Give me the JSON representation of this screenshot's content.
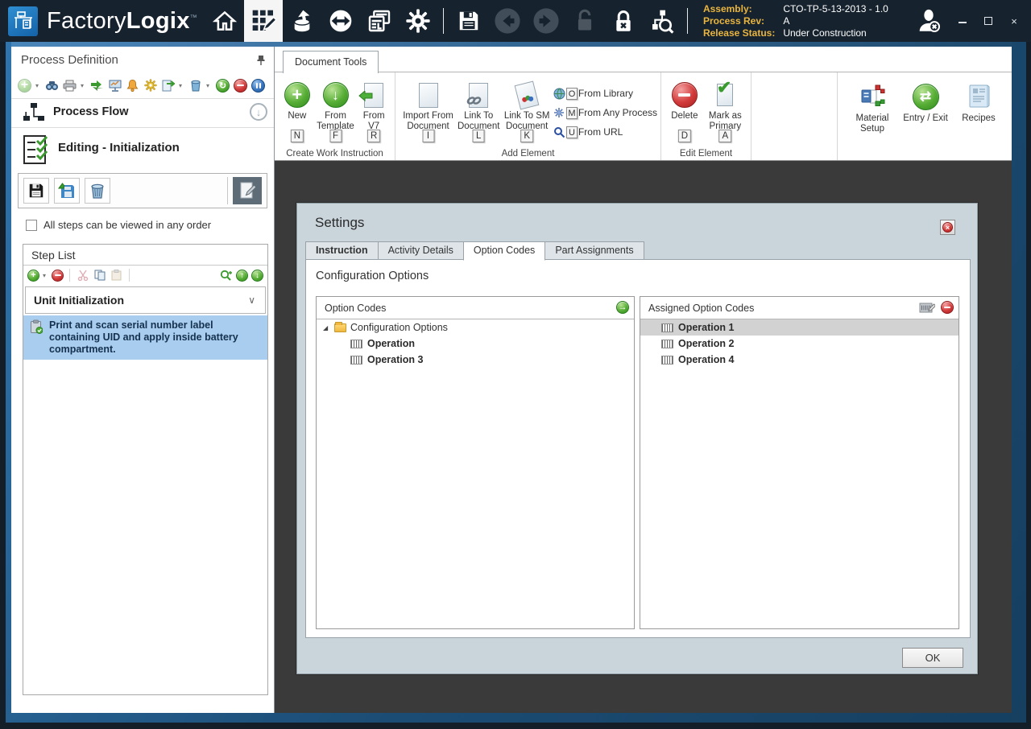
{
  "titlebar": {
    "brand_light": "Factory",
    "brand_bold": "Logix",
    "trademark": "™",
    "info": {
      "assembly_label": "Assembly:",
      "assembly_value": "CTO-TP-5-13-2013 - 1.0",
      "process_rev_label": "Process Rev:",
      "process_rev_value": "A",
      "release_status_label": "Release Status:",
      "release_status_value": "Under Construction"
    }
  },
  "left_panel": {
    "title": "Process Definition",
    "process_flow_label": "Process Flow",
    "editing_title": "Editing - Initialization",
    "steps_checkbox_label": "All steps can be viewed in any order",
    "step_list_title": "Step List",
    "step_group_title": "Unit Initialization",
    "step_text": "Print and scan serial number label containing UID and apply inside battery compartment."
  },
  "ribbon": {
    "tab_label": "Document Tools",
    "create_group": {
      "label": "Create Work Instruction",
      "new": {
        "label": "New",
        "keytip": "N"
      },
      "from_template": {
        "label": "From Template",
        "keytip": "F"
      },
      "from_v7": {
        "label": "From V7",
        "keytip": "R"
      }
    },
    "add_group": {
      "label": "Add Element",
      "import_from_document": {
        "label": "Import From Document",
        "keytip": "I"
      },
      "link_to_document": {
        "label": "Link To Document",
        "keytip": "L"
      },
      "link_to_sm_document": {
        "label": "Link To SM Document",
        "keytip": "K"
      },
      "from_library": {
        "label": "From Library",
        "keytip": "O"
      },
      "from_any_process": {
        "label": "From Any Process",
        "keytip": "M"
      },
      "from_url": {
        "label": "From URL",
        "keytip": "U"
      }
    },
    "edit_group": {
      "label": "Edit Element",
      "delete": {
        "label": "Delete",
        "keytip": "D"
      },
      "mark_as_primary": {
        "label": "Mark as Primary",
        "keytip": "A"
      }
    },
    "utility_group": {
      "material_setup": "Material Setup",
      "entry_exit": "Entry / Exit",
      "recipes": "Recipes"
    }
  },
  "dialog": {
    "title": "Settings",
    "tabs": {
      "instruction": "Instruction",
      "activity_details": "Activity Details",
      "option_codes": "Option Codes",
      "part_assignments": "Part Assignments"
    },
    "heading": "Configuration Options",
    "option_codes_panel": {
      "header": "Option Codes",
      "root": "Configuration Options",
      "items": [
        "Operation",
        "Operation 3"
      ]
    },
    "assigned_panel": {
      "header": "Assigned Option Codes",
      "items": [
        "Operation 1",
        "Operation 2",
        "Operation 4"
      ]
    },
    "ok_label": "OK"
  },
  "glyphs": {
    "caret_down": "▾",
    "chevron_down": "∨",
    "expander_expanded": "◢",
    "check": "✔",
    "arrow_right": "→",
    "arrow_up": "↑",
    "arrow_down": "↓",
    "arrow_left_right": "⇄",
    "pencil": "✎",
    "refresh": "↻",
    "close_x": "×",
    "plus": "+"
  },
  "colors": {
    "titlebar": "#16222e",
    "accent_blue": "#2f74ad",
    "selection_blue": "#a9cdee",
    "content_dark": "#3a3a3a",
    "dialog_bg": "#c9d4db",
    "info_label_yellow": "#e9b53f"
  }
}
